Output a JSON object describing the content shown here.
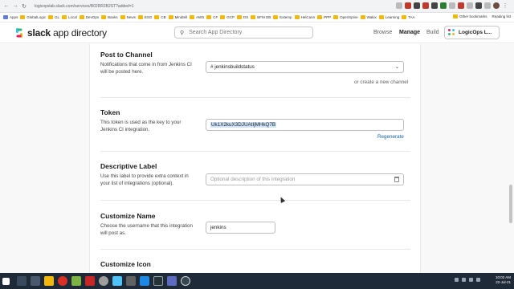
{
  "browser": {
    "url": "logicopslab.slack.com/services/B02RR2B2ST?added=1",
    "bookmarks": [
      "Apps",
      "GlobalLogic",
      "GL",
      "Local",
      "DevOps",
      "Banks",
      "News",
      "ESG",
      "CB",
      "Mindtell",
      "AWS",
      "CF",
      "GCP",
      "DS",
      "BFM DB",
      "Extemp",
      "HelCann",
      "PPP",
      "OpenSpine",
      "Wakix",
      "Learning",
      "TAA"
    ],
    "bookmarks_right": [
      "Other bookmarks",
      "Reading list"
    ]
  },
  "header": {
    "logo_bold": "slack",
    "logo_rest": " app directory",
    "search_placeholder": "Search App Directory",
    "nav": [
      "Browse",
      "Manage",
      "Build"
    ],
    "workspace": "LogicOps L..."
  },
  "sections": {
    "channel": {
      "title": "Post to Channel",
      "desc": "Notifications that come in from Jenkins CI will be posted here.",
      "value": "# jenkinsbuildstatus",
      "link": "or create a new channel"
    },
    "token": {
      "title": "Token",
      "desc": "This token is used as the key to your Jenkins CI integration.",
      "value": "Uk1X2kuX3DJUAtIjMHkQ7B",
      "link": "Regenerate"
    },
    "label": {
      "title": "Descriptive Label",
      "desc": "Use this label to provide extra context in your list of integrations (optional).",
      "placeholder": "Optional description of this integration"
    },
    "name": {
      "title": "Customize Name",
      "desc": "Choose the username that this integration will post as.",
      "value": "jenkins"
    },
    "icon": {
      "title": "Customize Icon"
    }
  },
  "taskbar": {
    "time": "10:02 AM",
    "date": "22-Jul-21"
  },
  "colors": {
    "link": "#1264a3",
    "taskbar": "#1f2a38"
  }
}
